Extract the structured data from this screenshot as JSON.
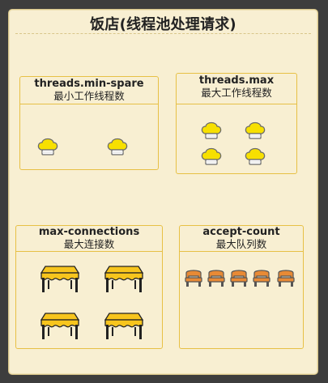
{
  "page": {
    "title": "饭店(线程池处理请求)"
  },
  "sections": {
    "min_spare": {
      "name": "threads.min-spare",
      "subtitle": "最小工作线程数",
      "icon": "chef-hat-icon",
      "count": 2
    },
    "max_threads": {
      "name": "threads.max",
      "subtitle": "最大工作线程数",
      "icon": "chef-hat-icon",
      "count": 4
    },
    "max_connections": {
      "name": "max-connections",
      "subtitle": "最大连接数",
      "icon": "table-icon",
      "count": 4
    },
    "accept_count": {
      "name": "accept-count",
      "subtitle": "最大队列数",
      "icon": "chair-icon",
      "count": 5
    }
  },
  "colors": {
    "background": "#3d3d3d",
    "panel": "#f8efd2",
    "box_border": "#e7c045",
    "hat_yellow": "#f7e000",
    "table_yellow": "#f7c51d",
    "chair_orange": "#e88a35"
  }
}
